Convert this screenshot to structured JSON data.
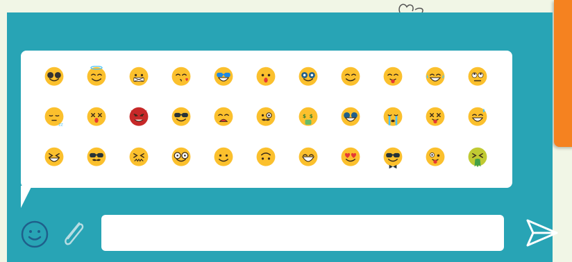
{
  "colors": {
    "panel": "#28a4b5",
    "popover": "#ffffff",
    "emoji_yellow": "#fbc02d",
    "accent_orange": "#f58220",
    "icon_blue": "#1f5f8b"
  },
  "composer": {
    "message_value": "",
    "message_placeholder": "",
    "emoji_toggle_icon": "smiley-icon",
    "attach_icon": "paperclip-icon",
    "send_icon": "send-arrow-icon"
  },
  "emoji_rows": [
    [
      "sunglasses-round",
      "innocent-halo",
      "mouth-tape",
      "kissing-heart",
      "cool-sunglasses",
      "surprised",
      "nerd-glasses",
      "smiling-eyes",
      "tongue-out",
      "tears-of-joy",
      "rolling-eyes"
    ],
    [
      "sleepy",
      "dizzy-face",
      "devil",
      "dark-sunglasses",
      "sad-frown",
      "monocle-mustache",
      "money-mouth",
      "blue-sunglasses-grin",
      "crying-stream",
      "dead-tongue",
      "sweat-grin"
    ],
    [
      "squint-laugh",
      "mustache-sunglasses",
      "confounded",
      "round-glasses",
      "smiling",
      "upside-down",
      "beaming",
      "heart-eyes",
      "bowtie-sunglasses",
      "goofy",
      "nauseated"
    ]
  ]
}
